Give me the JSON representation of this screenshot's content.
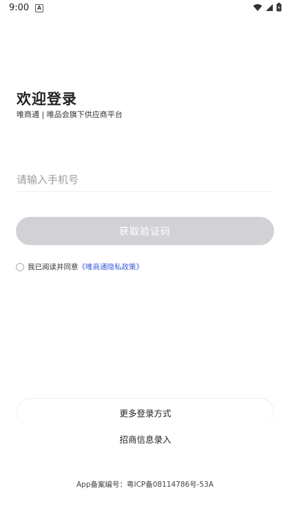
{
  "status_bar": {
    "time": "9:00",
    "a_label": "A",
    "icons": [
      "wifi-icon",
      "signal-icon",
      "battery-icon"
    ]
  },
  "header": {
    "title": "欢迎登录",
    "subtitle": "唯商通 | 唯品会旗下供应商平台"
  },
  "form": {
    "phone_placeholder": "请输入手机号",
    "phone_value": "",
    "get_code_label": "获取验证码",
    "agreement_prefix": "我已阅读并同意",
    "privacy_link": "《唯商通隐私政策》",
    "agreement_checked": false
  },
  "footer_actions": {
    "more_login": "更多登录方式",
    "merchant_entry": "招商信息录入"
  },
  "icp": {
    "text": "App备案编号：粤ICP备08114786号-53A"
  },
  "colors": {
    "button_disabled": "#d2d2d6",
    "link": "#3a5bd9",
    "text": "#222222"
  }
}
